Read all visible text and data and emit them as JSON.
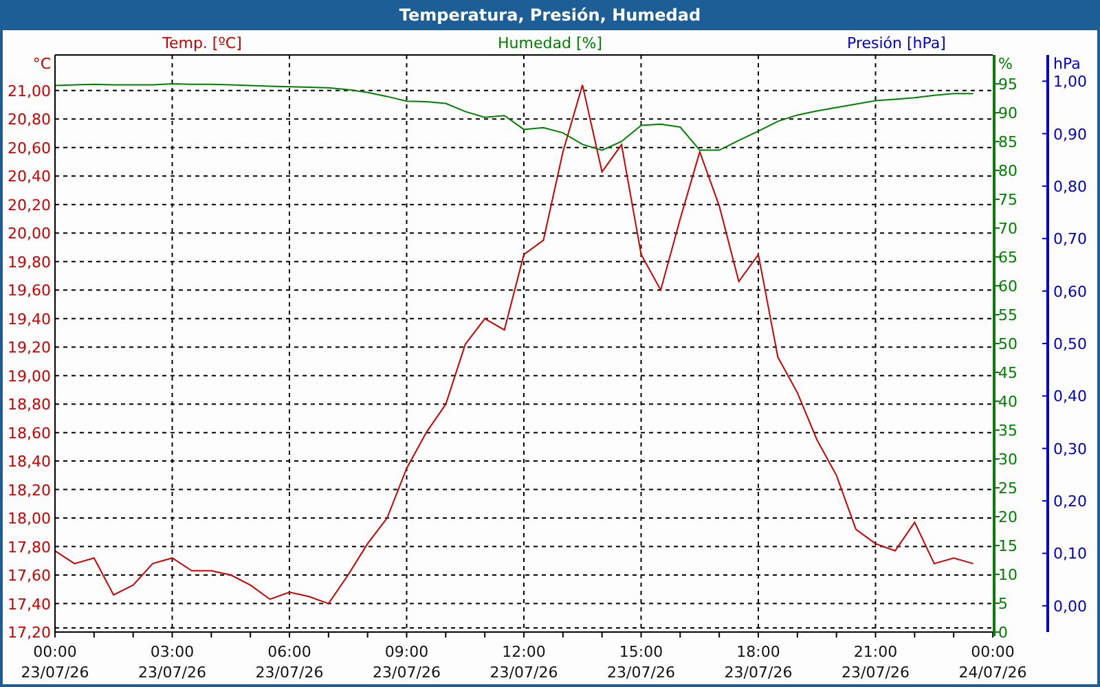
{
  "window": {
    "title": "Temperatura, Presión, Humedad"
  },
  "chart": {
    "units": [
      "°C",
      "%",
      "hPa"
    ],
    "chart_data": {
      "type": "line",
      "grid": true,
      "y3label": "Presión [hPa]",
      "categories": [
        "00:00 23/07/26",
        null,
        null,
        null,
        null,
        null,
        "03:00 23/07/26",
        null,
        null,
        null,
        null,
        null,
        "06:00 23/07/26",
        null,
        null,
        null,
        null,
        null,
        "09:00 23/07/26",
        null,
        null,
        null,
        null,
        null,
        "12:00 23/07/26",
        null,
        null,
        null,
        null,
        null,
        "15:00 23/07/26",
        null,
        null,
        null,
        null,
        null,
        "18:00 23/07/26",
        null,
        null,
        null,
        null,
        null,
        "21:00 23/07/26",
        null,
        null,
        null,
        null,
        null,
        "00:00 24/07/26"
      ],
      "series": [
        {
          "name": "Temp. [ºC]",
          "color": "#cc0000",
          "axis": "y",
          "values": [
            17.77,
            17.68,
            17.72,
            17.46,
            17.53,
            17.68,
            17.72,
            17.63,
            17.63,
            17.6,
            17.53,
            17.43,
            17.48,
            17.45,
            17.4,
            17.6,
            17.82,
            18.0,
            18.35,
            18.6,
            18.8,
            19.22,
            19.4,
            19.32,
            19.85,
            19.95,
            20.57,
            21.04,
            20.43,
            20.62,
            19.85,
            19.6,
            20.1,
            20.57,
            20.19,
            19.66,
            19.85,
            19.13,
            18.88,
            18.55,
            18.3,
            17.92,
            17.82,
            17.77,
            17.97,
            17.68,
            17.72,
            17.68,
            null
          ]
        },
        {
          "name": "Humedad [%]",
          "color": "#008000",
          "axis": "y2",
          "values": [
            94.7,
            94.8,
            94.9,
            94.8,
            94.8,
            94.8,
            95.0,
            94.9,
            94.9,
            94.8,
            94.7,
            94.6,
            94.5,
            94.4,
            94.3,
            94.0,
            93.5,
            92.8,
            92.0,
            91.9,
            91.6,
            90.2,
            89.2,
            89.5,
            87.1,
            87.4,
            86.5,
            84.5,
            83.5,
            85.0,
            87.8,
            88.0,
            87.5,
            83.5,
            83.5,
            85.2,
            86.8,
            88.5,
            89.6,
            90.3,
            90.9,
            91.5,
            92.1,
            92.3,
            92.6,
            93.0,
            93.3,
            93.3,
            null
          ]
        }
      ],
      "ylim": [
        17.2,
        21.25
      ],
      "y2lim": [
        0,
        100
      ],
      "y3lim": [
        -0.05,
        1.05
      ],
      "yticks": [
        {
          "value": 17.2,
          "label": "17,20"
        },
        {
          "value": 17.4,
          "label": "17,40"
        },
        {
          "value": 17.6,
          "label": "17,60"
        },
        {
          "value": 17.8,
          "label": "17,80"
        },
        {
          "value": 18.0,
          "label": "18,00"
        },
        {
          "value": 18.2,
          "label": "18,20"
        },
        {
          "value": 18.4,
          "label": "18,40"
        },
        {
          "value": 18.6,
          "label": "18,60"
        },
        {
          "value": 18.8,
          "label": "18,80"
        },
        {
          "value": 19.0,
          "label": "19,00"
        },
        {
          "value": 19.2,
          "label": "19,20"
        },
        {
          "value": 19.4,
          "label": "19,40"
        },
        {
          "value": 19.6,
          "label": "19,60"
        },
        {
          "value": 19.8,
          "label": "19,80"
        },
        {
          "value": 20.0,
          "label": "20,00"
        },
        {
          "value": 20.2,
          "label": "20,20"
        },
        {
          "value": 20.4,
          "label": "20,40"
        },
        {
          "value": 20.6,
          "label": "20,60"
        },
        {
          "value": 20.8,
          "label": "20,80"
        },
        {
          "value": 21.0,
          "label": "21,00"
        }
      ],
      "y2ticks": [
        0,
        5,
        10,
        15,
        20,
        25,
        30,
        35,
        40,
        45,
        50,
        55,
        60,
        65,
        70,
        75,
        80,
        85,
        90,
        95
      ],
      "y3ticks": [
        {
          "value": 0,
          "label": "0,00"
        },
        {
          "value": 0.1,
          "label": "0,10"
        },
        {
          "value": 0.2,
          "label": "0,20"
        },
        {
          "value": 0.3,
          "label": "0,30"
        },
        {
          "value": 0.4,
          "label": "0,40"
        },
        {
          "value": 0.5,
          "label": "0,50"
        },
        {
          "value": 0.6,
          "label": "0,60"
        },
        {
          "value": 0.7,
          "label": "0,70"
        },
        {
          "value": 0.8,
          "label": "0,80"
        },
        {
          "value": 0.9,
          "label": "0,90"
        },
        {
          "value": 1.0,
          "label": "1,00"
        }
      ]
    }
  }
}
